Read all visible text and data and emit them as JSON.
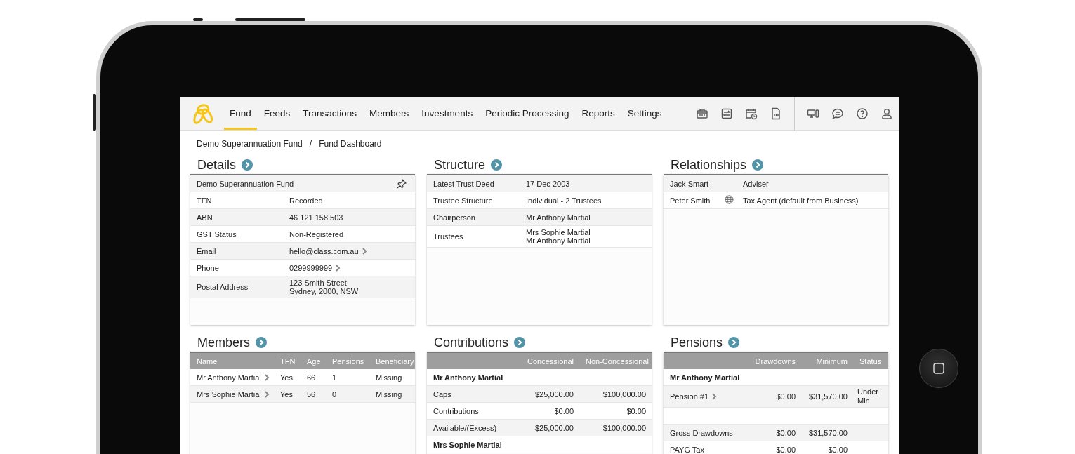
{
  "nav": {
    "items": [
      {
        "label": "Fund",
        "selected": true
      },
      {
        "label": "Feeds",
        "selected": false
      },
      {
        "label": "Transactions",
        "selected": false
      },
      {
        "label": "Members",
        "selected": false
      },
      {
        "label": "Investments",
        "selected": false
      },
      {
        "label": "Periodic Processing",
        "selected": false
      },
      {
        "label": "Reports",
        "selected": false
      },
      {
        "label": "Settings",
        "selected": false
      }
    ]
  },
  "breadcrumb": {
    "items": [
      "Demo Superannuation Fund",
      "Fund Dashboard"
    ],
    "separator": "/"
  },
  "details": {
    "title": "Details",
    "header": "Demo Superannuation Fund",
    "rows": [
      {
        "label": "TFN",
        "lines": [
          "Recorded"
        ],
        "link": false
      },
      {
        "label": "ABN",
        "lines": [
          "46 121 158 503"
        ],
        "link": false
      },
      {
        "label": "GST Status",
        "lines": [
          "Non-Registered"
        ],
        "link": false
      },
      {
        "label": "Email",
        "lines": [
          "hello@class.com.au"
        ],
        "link": true
      },
      {
        "label": "Phone",
        "lines": [
          "0299999999"
        ],
        "link": true
      },
      {
        "label": "Postal Address",
        "lines": [
          "123 Smith Street",
          "Sydney, 2000, NSW"
        ],
        "link": false
      }
    ]
  },
  "structure": {
    "title": "Structure",
    "rows": [
      {
        "label": "Latest Trust Deed",
        "lines": [
          "17 Dec 2003"
        ]
      },
      {
        "label": "Trustee Structure",
        "lines": [
          "Individual - 2 Trustees"
        ]
      },
      {
        "label": "Chairperson",
        "lines": [
          "Mr Anthony Martial"
        ]
      },
      {
        "label": "Trustees",
        "lines": [
          "Mrs Sophie Martial",
          "Mr Anthony Martial"
        ]
      }
    ]
  },
  "relationships": {
    "title": "Relationships",
    "rows": [
      {
        "name": "Jack Smart",
        "role": "Adviser",
        "web": false
      },
      {
        "name": "Peter Smith",
        "role": "Tax Agent (default from Business)",
        "web": true
      }
    ]
  },
  "members": {
    "title": "Members",
    "columns": [
      "Name",
      "TFN",
      "Age",
      "Pensions",
      "Beneficiary"
    ],
    "rows": [
      {
        "cells": [
          "Mr Anthony Martial",
          "Yes",
          "66",
          "1",
          "Missing"
        ]
      },
      {
        "cells": [
          "Mrs Sophie Martial",
          "Yes",
          "56",
          "0",
          "Missing"
        ]
      }
    ]
  },
  "contributions": {
    "title": "Contributions",
    "columns": [
      "Concessional",
      "Non-Concessional"
    ],
    "rows": [
      {
        "kind": "group",
        "label": "Mr Anthony Martial"
      },
      {
        "kind": "line",
        "label": "Caps",
        "link": false,
        "values": [
          "$25,000.00",
          "$100,000.00"
        ]
      },
      {
        "kind": "line",
        "label": "Contributions",
        "link": false,
        "values": [
          "$0.00",
          "$0.00"
        ]
      },
      {
        "kind": "line",
        "label": "Available/(Excess)",
        "link": false,
        "values": [
          "$25,000.00",
          "$100,000.00"
        ]
      },
      {
        "kind": "group",
        "label": "Mrs Sophie Martial"
      }
    ]
  },
  "pensions": {
    "title": "Pensions",
    "columns": [
      "Drawdowns",
      "Minimum",
      "Status"
    ],
    "rows": [
      {
        "kind": "group",
        "label": "Mr Anthony Martial"
      },
      {
        "kind": "line",
        "label": "Pension #1",
        "link": true,
        "values": [
          "$0.00",
          "$31,570.00",
          "Under Min"
        ]
      },
      {
        "kind": "blank"
      },
      {
        "kind": "line",
        "label": "Gross Drawdowns",
        "link": false,
        "values": [
          "$0.00",
          "$31,570.00"
        ]
      },
      {
        "kind": "line",
        "label": "PAYG Tax",
        "link": false,
        "values": [
          "$0.00",
          "$0.00"
        ]
      }
    ]
  }
}
